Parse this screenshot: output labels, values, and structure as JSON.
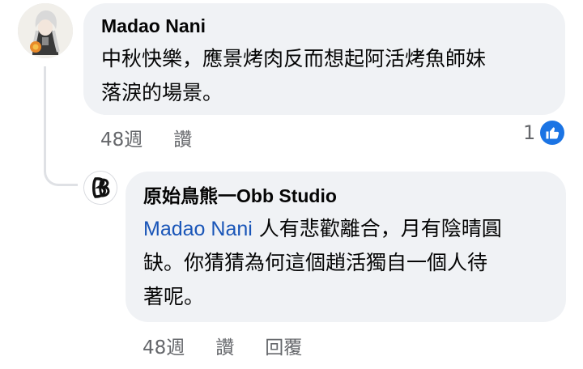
{
  "comment": {
    "author": "Madao Nani",
    "text_line1": "中秋快樂，應景烤肉反而想起阿活烤魚師妹",
    "text_line2": "落淚的場景。",
    "time": "48週",
    "like_label": "讚",
    "reaction_count": "1",
    "reaction_icon": "thumbs-up-icon",
    "accent_color": "#1b74e4"
  },
  "reply": {
    "author": "原始鳥熊一Obb Studio",
    "mention": "Madao Nani",
    "text_line1_rest": " 人有悲歡離合，月有陰晴圓",
    "text_line2": "缺。你猜猜為何這個趙活獨自一個人待",
    "text_line3": "著呢。",
    "time": "48週",
    "like_label": "讚",
    "reply_label": "回覆",
    "mention_color": "#1a56b8"
  }
}
